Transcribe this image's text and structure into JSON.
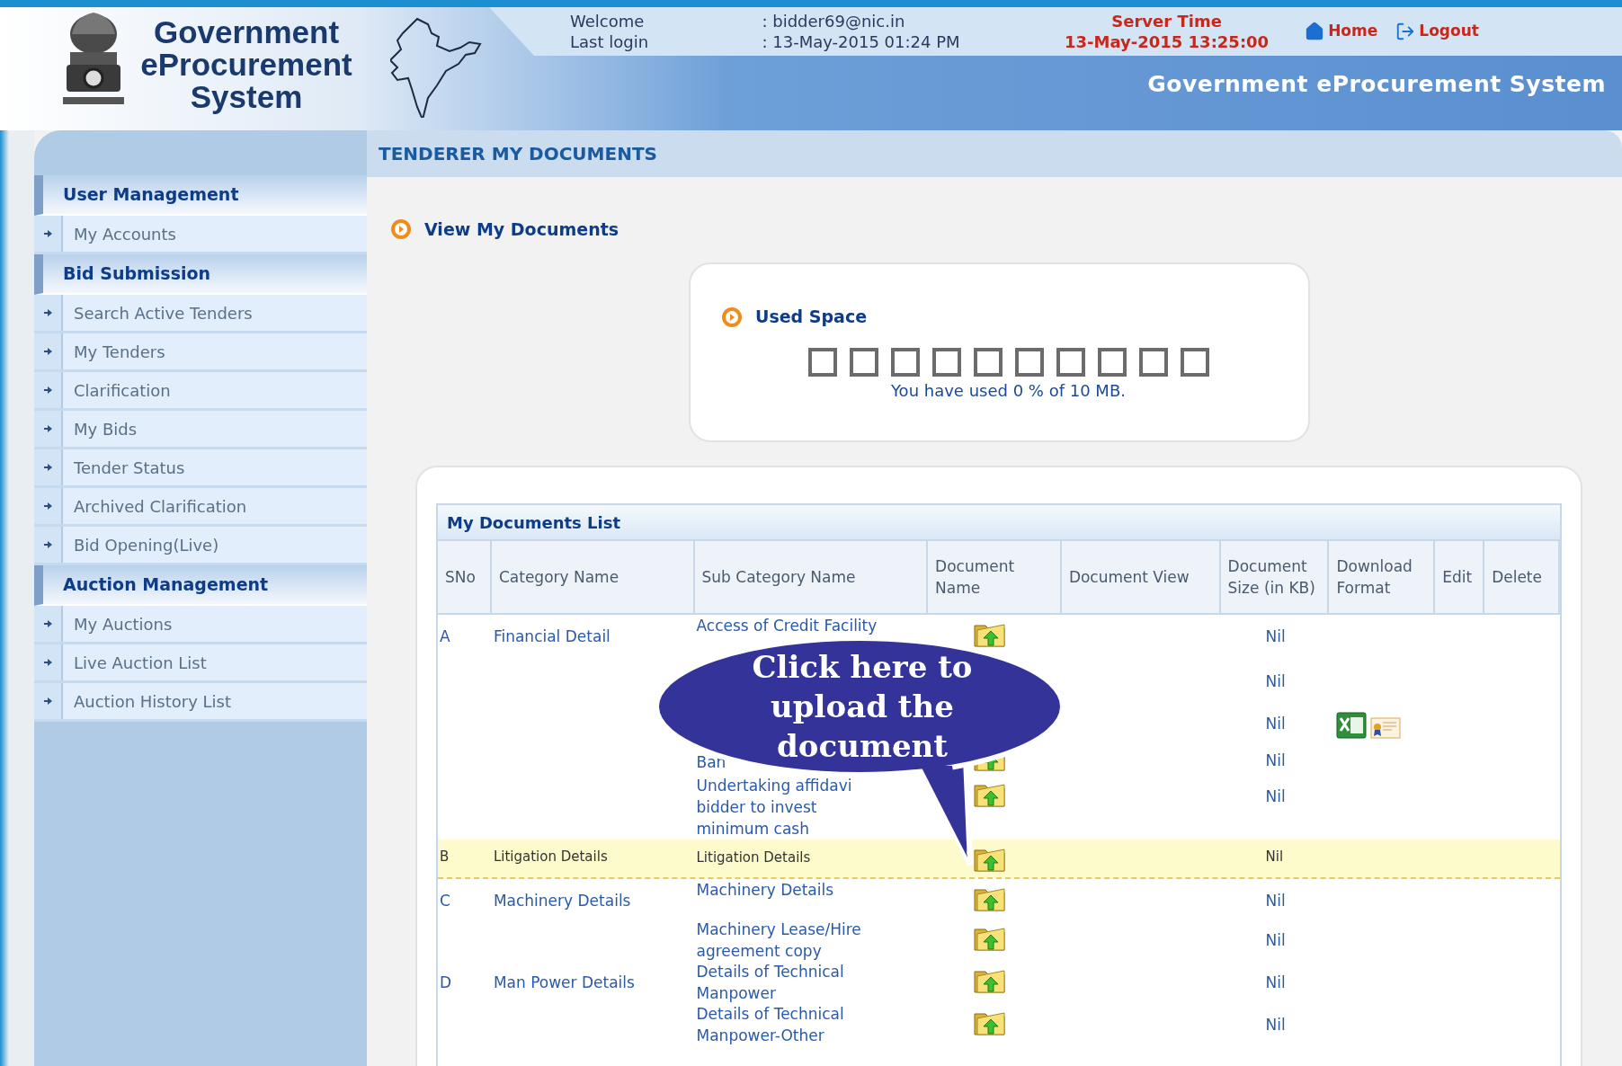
{
  "header": {
    "logo_text": "Government eProcurement System",
    "welcome_label": "Welcome",
    "welcome_value": ": bidder69@nic.in",
    "last_login_label": "Last login",
    "last_login_value": ": 13-May-2015 01:24 PM",
    "server_time_label": "Server Time",
    "server_time": "13-May-2015 13:25:00",
    "links": [
      {
        "label": "Home",
        "kind": "home"
      },
      {
        "label": "Logout",
        "kind": "logout"
      }
    ],
    "system_title": "Government eProcurement System"
  },
  "sidebar": {
    "sections": [
      {
        "title": "User Management",
        "items": [
          "My Accounts"
        ]
      },
      {
        "title": "Bid Submission",
        "items": [
          "Search Active Tenders",
          "My Tenders",
          "Clarification",
          "My Bids",
          "Tender Status",
          "Archived Clarification",
          "Bid Opening(Live)"
        ]
      },
      {
        "title": "Auction Management",
        "items": [
          "My Auctions",
          "Live Auction List",
          "Auction History List"
        ]
      }
    ]
  },
  "page_title": "TENDERER MY DOCUMENTS",
  "section_link": "View My Documents",
  "used_space": {
    "title": "Used Space",
    "level": 0,
    "caption": "You have used 0 % of 10 MB."
  },
  "documents_list": {
    "title": "My Documents List",
    "columns": [
      "SNo",
      "Category Name",
      "Sub Category Name",
      "Document Name",
      "Document View",
      "Document Size (in KB)",
      "Download Format",
      "Edit",
      "Delete"
    ],
    "rows": [
      {
        "sno": "A",
        "category": "Financial Detail",
        "sub_category": "Access of Credit Facility",
        "upload": true,
        "size": "Nil",
        "download_format": false,
        "highlighted": false
      },
      {
        "sno": "",
        "category": "",
        "sub_category": "",
        "size": "Nil",
        "download_format": false,
        "highlighted": false
      },
      {
        "sno": "",
        "category": "",
        "sub_category": "",
        "size": "Nil",
        "download_format": true,
        "highlighted": false
      },
      {
        "sno": "",
        "category": "",
        "sub_category": "Ban",
        "upload": true,
        "size": "Nil",
        "download_format": false,
        "highlighted": false
      },
      {
        "sno": "",
        "category": "",
        "sub_category": "Undertaking affidavi bidder to invest minimum cash",
        "upload": true,
        "size": "Nil",
        "download_format": false,
        "highlighted": false
      },
      {
        "sno": "B",
        "category": "Litigation Details",
        "sub_category": "Litigation Details",
        "upload": true,
        "size": "Nil",
        "download_format": false,
        "highlighted": true
      },
      {
        "sno": "C",
        "category": "Machinery Details",
        "sub_category": "Machinery Details",
        "upload": true,
        "size": "Nil",
        "download_format": false,
        "highlighted": false
      },
      {
        "sno": "",
        "category": "",
        "sub_category": "Machinery Lease/Hire agreement copy",
        "upload": true,
        "size": "Nil",
        "download_format": false,
        "highlighted": false
      },
      {
        "sno": "D",
        "category": "Man Power Details",
        "sub_category": "Details of Technical Manpower",
        "upload": true,
        "size": "Nil",
        "download_format": false,
        "highlighted": false
      },
      {
        "sno": "",
        "category": "",
        "sub_category": "Details of Technical Manpower-Other",
        "upload": true,
        "size": "Nil",
        "download_format": false,
        "highlighted": false
      }
    ]
  },
  "callout": {
    "text": "Click here to upload the document"
  }
}
